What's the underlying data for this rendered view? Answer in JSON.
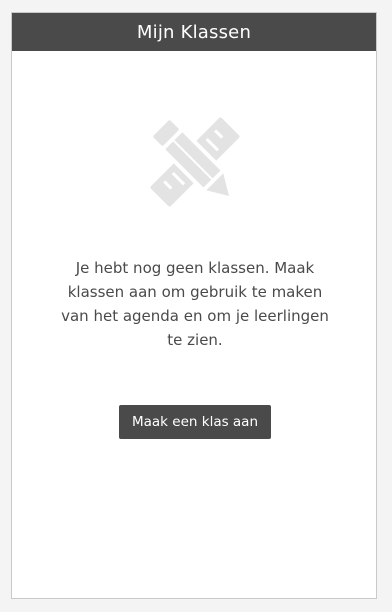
{
  "panel": {
    "title": "Mijn Klassen"
  },
  "empty_state": {
    "icon": "pencil-ruler-icon",
    "message": "Je hebt nog geen klassen. Maak klassen aan om gebruik te maken van het agenda en om je leerlingen te zien.",
    "button_label": "Maak een klas aan"
  },
  "colors": {
    "header_bg": "#4a4a4a",
    "button_bg": "#4a4a4a",
    "icon": "#e3e3e3",
    "text": "#4a4a4a",
    "page_bg": "#f4f4f4"
  }
}
